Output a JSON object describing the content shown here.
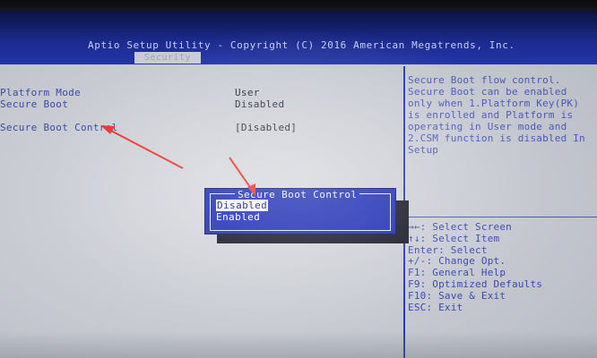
{
  "header": {
    "title": "Aptio Setup Utility - Copyright (C) 2016 American Megatrends, Inc.",
    "tab": "Security"
  },
  "settings": [
    {
      "label": "Platform Mode",
      "value": "User"
    },
    {
      "label": "Secure Boot",
      "value": "Disabled"
    },
    {
      "label": "Secure Boot Control",
      "value": "[Disabled]"
    }
  ],
  "help": {
    "lines": [
      "Secure Boot flow control.",
      "Secure Boot can be enabled",
      "only when 1.Platform Key(PK)",
      "is enrolled and Platform is",
      "operating in User mode and",
      "2.CSM function is disabled In",
      "Setup"
    ]
  },
  "keys": [
    "→←: Select Screen",
    "↑↓: Select Item",
    "Enter: Select",
    "+/-: Change Opt.",
    "F1: General Help",
    "F9: Optimized Defaults",
    "F10: Save & Exit",
    "ESC: Exit"
  ],
  "popup": {
    "title": "Secure Boot Control",
    "options": [
      "Disabled",
      "Enabled"
    ],
    "selected": "Disabled"
  },
  "colors": {
    "bios_blue": "#1f2fb4",
    "annotation_arrow": "#e8352a"
  }
}
